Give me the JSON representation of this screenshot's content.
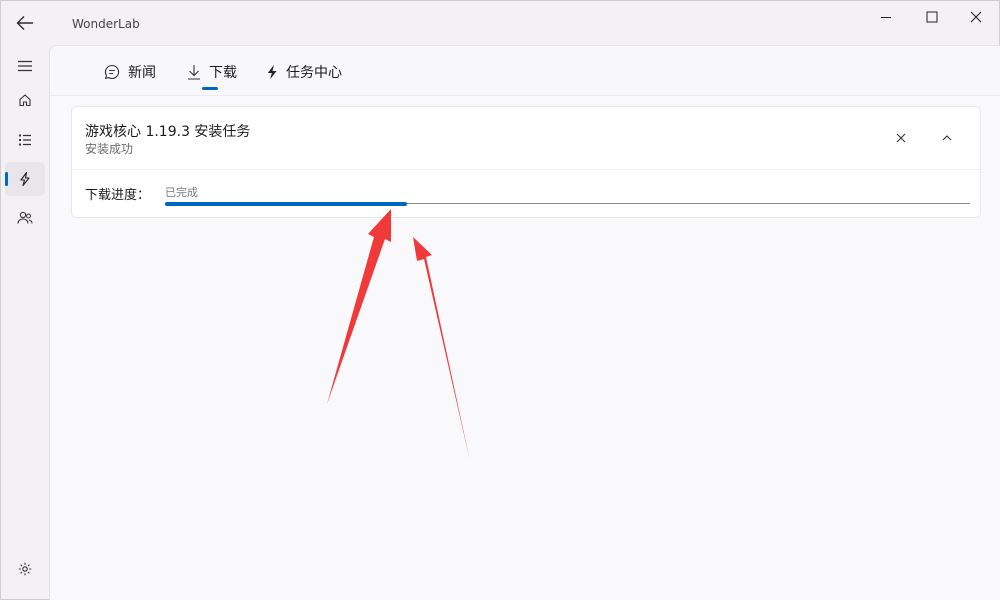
{
  "app": {
    "title": "WonderLab"
  },
  "tabs": [
    {
      "label": "新闻",
      "icon": "chat-icon"
    },
    {
      "label": "下载",
      "icon": "download-icon",
      "selected": true
    },
    {
      "label": "任务中心",
      "icon": "lightning-icon"
    }
  ],
  "sidebar": {
    "items": [
      {
        "name": "menu",
        "icon": "hamburger-icon"
      },
      {
        "name": "home",
        "icon": "home-icon"
      },
      {
        "name": "list",
        "icon": "list-icon"
      },
      {
        "name": "tasks",
        "icon": "lightning-icon",
        "active": true
      },
      {
        "name": "users",
        "icon": "users-icon"
      },
      {
        "name": "settings",
        "icon": "gear-icon"
      }
    ]
  },
  "task": {
    "title": "游戏核心 1.19.3 安装任务",
    "status": "安装成功",
    "progress_label": "下载进度：",
    "progress_state": "已完成",
    "progress_fraction": 0.3
  },
  "colors": {
    "accent": "#0067c0",
    "annotation_arrow": "#f03a3a"
  }
}
